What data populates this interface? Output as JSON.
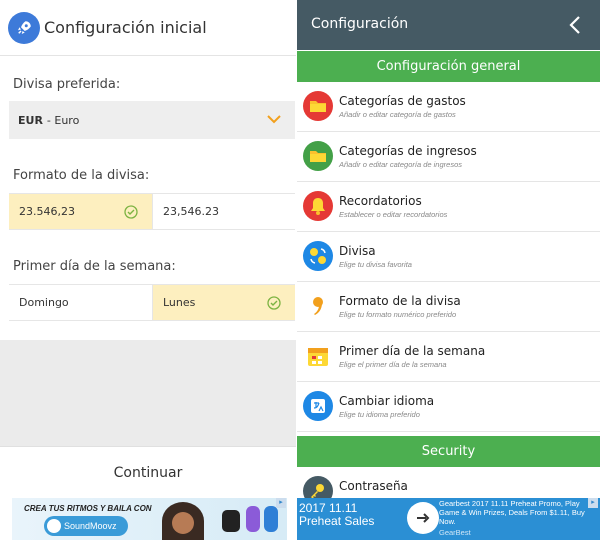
{
  "left": {
    "title": "Configuración inicial",
    "currency": {
      "label": "Divisa preferida:",
      "code": "EUR",
      "name": " - Euro"
    },
    "format": {
      "label": "Formato de la divisa:",
      "options": [
        "23.546,23",
        "23,546.23"
      ],
      "selected_index": 0
    },
    "weekday": {
      "label": "Primer día de la semana:",
      "options": [
        "Domingo",
        "Lunes"
      ],
      "selected_index": 1
    },
    "continue_label": "Continuar"
  },
  "ad_left": {
    "text": "CREA TUS RITMOS Y BAILA CON",
    "brand": "SoundMoovz"
  },
  "right": {
    "title": "Configuración",
    "sections": {
      "general": "Configuración general",
      "security": "Security"
    },
    "items": [
      {
        "title": "Categorías de gastos",
        "subtitle": "Añadir o editar categoría de gastos",
        "icon": "folder-icon",
        "color": "#e53935"
      },
      {
        "title": "Categorías de ingresos",
        "subtitle": "Añadir o editar categoría de ingresos",
        "icon": "folder-icon",
        "color": "#43a047"
      },
      {
        "title": "Recordatorios",
        "subtitle": "Establecer o editar recordatorios",
        "icon": "bell-icon",
        "color": "#e53935"
      },
      {
        "title": "Divisa",
        "subtitle": "Elige tu divisa favorita",
        "icon": "currency-exchange-icon",
        "color": "#1e88e5"
      },
      {
        "title": "Formato de la divisa",
        "subtitle": "Elige tu formato numérico preferido",
        "icon": "comma-icon",
        "color": "#ffffff"
      },
      {
        "title": "Primer día de la semana",
        "subtitle": "Elige el primer día de la semana",
        "icon": "calendar-icon",
        "color": "#ffffff"
      },
      {
        "title": "Cambiar idioma",
        "subtitle": "Elige tu idioma preferido",
        "icon": "language-icon",
        "color": "#1e88e5"
      }
    ],
    "security_items": [
      {
        "title": "Contraseña",
        "icon": "key-icon",
        "color": "#455a64"
      }
    ]
  },
  "ad_right": {
    "headline": "2017 11.11 Preheat Sales",
    "body": "Gearbest 2017 11.11 Preheat Promo, Play Game & Win Prizes, Deals From $1.11, Buy Now.",
    "brand": "GearBest"
  },
  "colors": {
    "header_dark": "#455a64",
    "section_green": "#4caf50",
    "selected_option": "#fdefbf",
    "accent_orange": "#f2a01d",
    "check_green": "#7cb342"
  }
}
